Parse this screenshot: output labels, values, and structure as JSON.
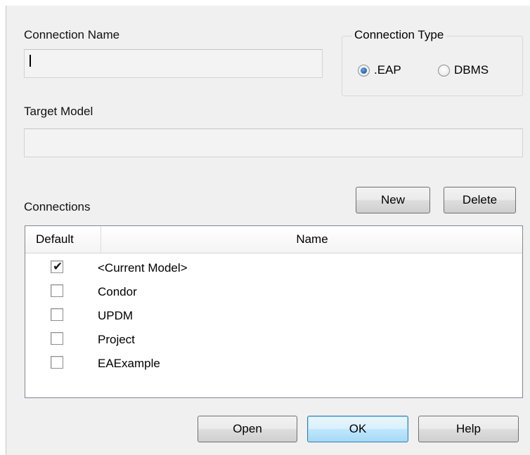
{
  "connection_name": {
    "label": "Connection Name",
    "value": ""
  },
  "connection_type": {
    "legend": "Connection Type",
    "options": [
      {
        "label": ".EAP",
        "checked": true
      },
      {
        "label": "DBMS",
        "checked": false
      }
    ]
  },
  "target_model": {
    "label": "Target Model",
    "value": ""
  },
  "connections": {
    "label": "Connections",
    "new_label": "New",
    "delete_label": "Delete",
    "columns": [
      "Default",
      "Name"
    ],
    "rows": [
      {
        "name": "<Current Model>",
        "default": true
      },
      {
        "name": "Condor",
        "default": false
      },
      {
        "name": "UPDM",
        "default": false
      },
      {
        "name": "Project",
        "default": false
      },
      {
        "name": "EAExample",
        "default": false
      }
    ]
  },
  "footer": {
    "open_label": "Open",
    "ok_label": "OK",
    "help_label": "Help"
  },
  "colors": {
    "dialog_bg": "#f0f0f0",
    "default_button": "#bee6fd",
    "radio_selected": "#1f5fae"
  },
  "icons": {
    "checked": "check-mark-icon"
  }
}
